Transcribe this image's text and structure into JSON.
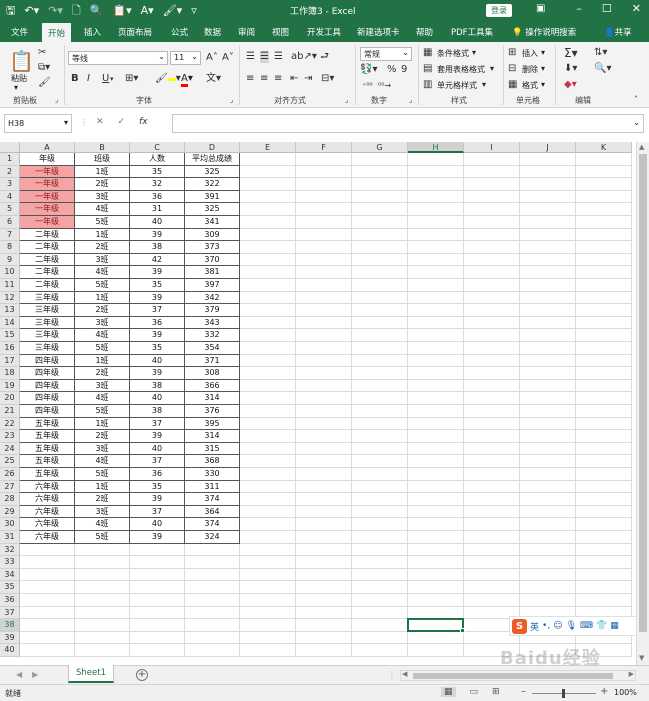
{
  "window": {
    "title": "工作簿3 - Excel",
    "login_label": "登录"
  },
  "ribbon_tabs": [
    "文件",
    "开始",
    "插入",
    "页面布局",
    "公式",
    "数据",
    "审阅",
    "视图",
    "开发工具",
    "新建选项卡",
    "帮助",
    "PDF工具集"
  ],
  "active_tab": "开始",
  "tell_me": "操作说明搜索",
  "share": "共享",
  "ribbon": {
    "clipboard": {
      "label": "剪贴板",
      "paste": "粘贴"
    },
    "font": {
      "label": "字体",
      "name": "等线",
      "size": "11",
      "bold": "B",
      "italic": "I",
      "underline": "U",
      "font_color": "#FF0000",
      "fill_color": "#FFFF00"
    },
    "alignment": {
      "label": "对齐方式"
    },
    "number": {
      "label": "数字",
      "format": "常规",
      "percent": "%",
      "comma": "9"
    },
    "styles": {
      "label": "样式",
      "conditional": "条件格式",
      "table": "套用表格格式",
      "cell": "单元格样式"
    },
    "cells": {
      "label": "单元格",
      "insert": "插入",
      "delete": "删除",
      "format": "格式"
    },
    "editing": {
      "label": "编辑"
    }
  },
  "formula_bar": {
    "name_box": "H38",
    "formula": "",
    "fx": "fx"
  },
  "sheet": {
    "columns": [
      "A",
      "B",
      "C",
      "D",
      "E",
      "F",
      "G",
      "H",
      "I",
      "J",
      "K"
    ],
    "selected_column": "H",
    "selected_row": "38",
    "rows": [
      "1",
      "2",
      "3",
      "4",
      "5",
      "6",
      "7",
      "8",
      "9",
      "10",
      "11",
      "12",
      "13",
      "14",
      "15",
      "16",
      "17",
      "18",
      "19",
      "20",
      "21",
      "22",
      "23",
      "24",
      "25",
      "26",
      "27",
      "28",
      "29",
      "30",
      "31",
      "32",
      "33",
      "34",
      "35",
      "36",
      "37",
      "38",
      "39",
      "40"
    ],
    "headers": [
      "年级",
      "班级",
      "人数",
      "平均总成绩"
    ],
    "highlight_color": "#f4a4a4",
    "data": [
      [
        "一年级",
        "1班",
        "35",
        "325"
      ],
      [
        "一年级",
        "2班",
        "32",
        "322"
      ],
      [
        "一年级",
        "3班",
        "36",
        "391"
      ],
      [
        "一年级",
        "4班",
        "31",
        "325"
      ],
      [
        "一年级",
        "5班",
        "40",
        "341"
      ],
      [
        "二年级",
        "1班",
        "39",
        "309"
      ],
      [
        "二年级",
        "2班",
        "38",
        "373"
      ],
      [
        "二年级",
        "3班",
        "42",
        "370"
      ],
      [
        "二年级",
        "4班",
        "39",
        "381"
      ],
      [
        "二年级",
        "5班",
        "35",
        "397"
      ],
      [
        "三年级",
        "1班",
        "39",
        "342"
      ],
      [
        "三年级",
        "2班",
        "37",
        "379"
      ],
      [
        "三年级",
        "3班",
        "36",
        "343"
      ],
      [
        "三年级",
        "4班",
        "39",
        "332"
      ],
      [
        "三年级",
        "5班",
        "35",
        "354"
      ],
      [
        "四年级",
        "1班",
        "40",
        "371"
      ],
      [
        "四年级",
        "2班",
        "39",
        "308"
      ],
      [
        "四年级",
        "3班",
        "38",
        "366"
      ],
      [
        "四年级",
        "4班",
        "40",
        "314"
      ],
      [
        "四年级",
        "5班",
        "38",
        "376"
      ],
      [
        "五年级",
        "1班",
        "37",
        "395"
      ],
      [
        "五年级",
        "2班",
        "39",
        "314"
      ],
      [
        "五年级",
        "3班",
        "40",
        "315"
      ],
      [
        "五年级",
        "4班",
        "37",
        "368"
      ],
      [
        "五年级",
        "5班",
        "36",
        "330"
      ],
      [
        "六年级",
        "1班",
        "35",
        "311"
      ],
      [
        "六年级",
        "2班",
        "39",
        "374"
      ],
      [
        "六年级",
        "3班",
        "37",
        "364"
      ],
      [
        "六年级",
        "4班",
        "40",
        "374"
      ],
      [
        "六年级",
        "5班",
        "39",
        "324"
      ]
    ]
  },
  "sheet_tabs": {
    "active": "Sheet1"
  },
  "status": {
    "ready": "就绪",
    "zoom": "100%"
  },
  "ime": {
    "lang": "英"
  },
  "watermark": "Baidu经验"
}
